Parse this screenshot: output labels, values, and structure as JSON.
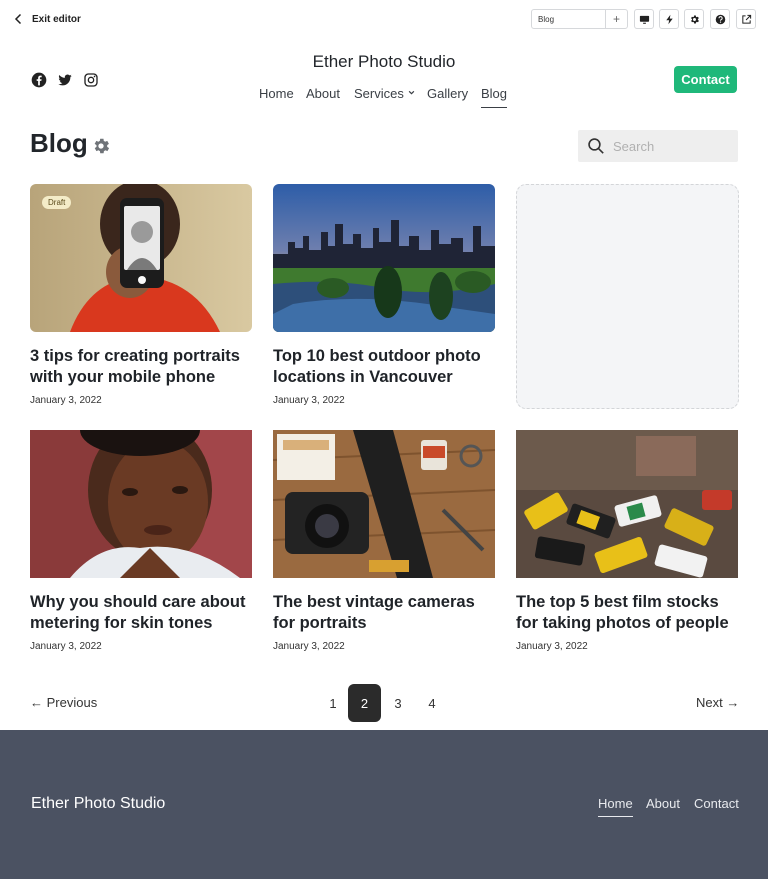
{
  "editor": {
    "exit_label": "Exit editor",
    "page_select_value": "Blog",
    "add_page_label": "+"
  },
  "site": {
    "title": "Ether Photo Studio",
    "contact_button": "Contact",
    "nav": [
      {
        "label": "Home"
      },
      {
        "label": "About"
      },
      {
        "label": "Services"
      },
      {
        "label": "Gallery"
      },
      {
        "label": "Blog",
        "active": true
      }
    ],
    "social_icons": [
      "facebook-icon",
      "twitter-icon",
      "instagram-icon"
    ]
  },
  "blog": {
    "heading": "Blog",
    "search_placeholder": "Search",
    "posts": [
      {
        "title": "3 tips for creating portraits with your mobile phone",
        "date": "January 3, 2022",
        "badge": "Draft"
      },
      {
        "title": "Top 10 best outdoor photo locations in Vancouver",
        "date": "January 3, 2022"
      },
      {
        "title": "Why you should care about metering for skin tones",
        "date": "January 3, 2022"
      },
      {
        "title": "The best vintage cameras for portraits",
        "date": "January 3, 2022"
      },
      {
        "title": "The top 5 best film stocks for taking photos of people",
        "date": "January 3, 2022"
      }
    ]
  },
  "pagination": {
    "previous": "← Previous",
    "next": "Next →",
    "pages": [
      "1",
      "2",
      "3",
      "4"
    ],
    "current": "2"
  },
  "footer": {
    "brand": "Ether Photo Studio",
    "links": [
      {
        "label": "Home",
        "active": true
      },
      {
        "label": "About"
      },
      {
        "label": "Contact"
      }
    ]
  },
  "colors": {
    "accent": "#1fb87a",
    "footer_bg": "#4b5262",
    "current_page_bg": "#2b2b2b"
  }
}
